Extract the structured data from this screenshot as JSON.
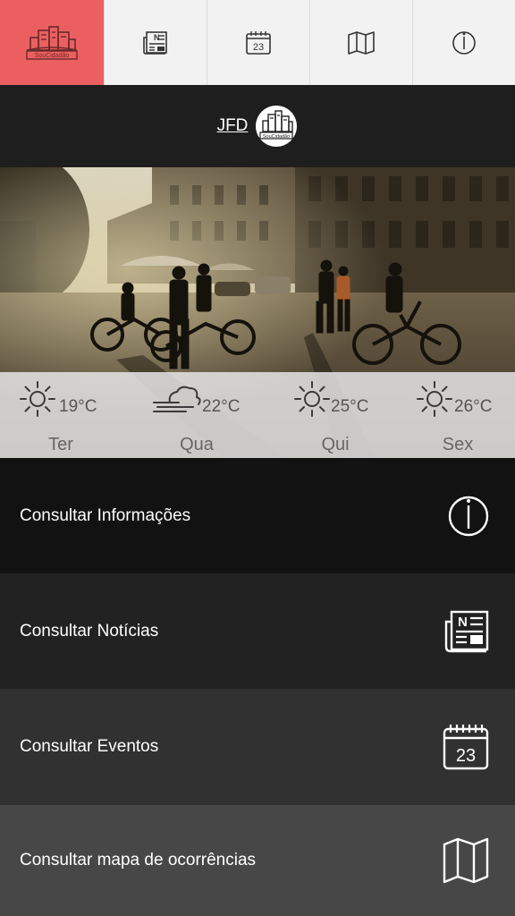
{
  "nav": {
    "logo_text": "SouCidadão",
    "tabs": [
      {
        "icon": "newspaper-icon"
      },
      {
        "icon": "calendar-icon",
        "label": "23"
      },
      {
        "icon": "map-icon"
      },
      {
        "icon": "info-icon"
      }
    ]
  },
  "brand": {
    "city": "JFD",
    "logo_text": "SouCidadão"
  },
  "weather": [
    {
      "temp": "19°C",
      "day": "Ter",
      "icon": "sun-icon"
    },
    {
      "temp": "22°C",
      "day": "Qua",
      "icon": "wind-cloud-icon"
    },
    {
      "temp": "25°C",
      "day": "Qui",
      "icon": "sun-icon"
    },
    {
      "temp": "26°C",
      "day": "Sex",
      "icon": "sun-icon"
    }
  ],
  "menu": [
    {
      "label": "Consultar Informações",
      "icon": "info-icon",
      "color": "#121212"
    },
    {
      "label": "Consultar Notícias",
      "icon": "newspaper-icon",
      "color": "#222222"
    },
    {
      "label": "Consultar Eventos",
      "icon": "calendar-icon",
      "color": "#313131",
      "icon_text": "23"
    },
    {
      "label": "Consultar mapa de ocorrências",
      "icon": "map-icon",
      "color": "#474747"
    }
  ],
  "colors": {
    "accent": "#ec5f60"
  }
}
